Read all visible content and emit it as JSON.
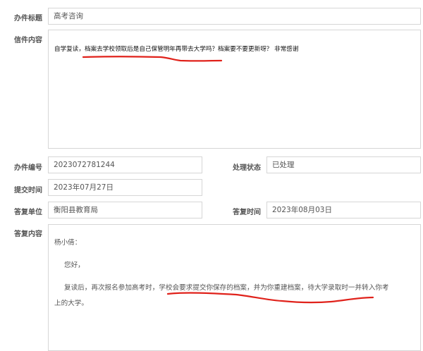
{
  "form": {
    "title_label": "办件标题",
    "title_value": "高考咨询",
    "letter_label": "信件内容",
    "letter_text": "自学复读，档案去学校领取后是自己保管明年再带去大学吗？档案要不要更新呀？   非常感谢",
    "case_no_label": "办件编号",
    "case_no_value": "2023072781244",
    "status_label": "处理状态",
    "status_value": "已处理",
    "submit_time_label": "提交时间",
    "submit_time_value": "2023年07月27日",
    "reply_unit_label": "答复单位",
    "reply_unit_value": "衡阳县教育局",
    "reply_time_label": "答复时间",
    "reply_time_value": "2023年08月03日",
    "reply_content_label": "答复内容",
    "reply": {
      "salutation": "杨小倩：",
      "greeting": "您好，",
      "body_line1": "复读后，再次报名参加高考时，学校会要求提交你保存的档案，并为你重建档案，待大学录取时一并转入你考",
      "body_line2": "上的大学。"
    }
  },
  "annotation_color": "#e0221b"
}
